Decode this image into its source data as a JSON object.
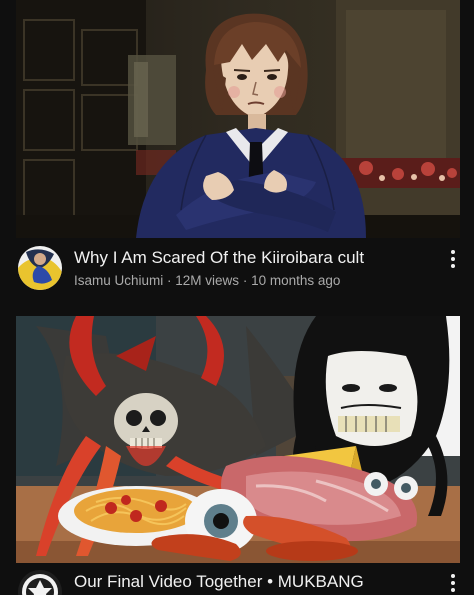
{
  "feed": {
    "videos": [
      {
        "title": "Why I Am Scared Of the Kiiroibara cult",
        "channel": "Isamu Uchiumi",
        "views": "12M views",
        "age": "10 months ago",
        "thumbnail_icon": "anime-character-thumbnail",
        "avatar_icon": "channel-avatar-blue-yellow"
      },
      {
        "title": "Our Final Video Together • MUKBANG",
        "thumbnail_icon": "mukbang-horror-thumbnail",
        "avatar_icon": "channel-avatar-crest"
      }
    ]
  },
  "colors": {
    "background": "#0f0f0f",
    "title_text": "#f1f1f1",
    "secondary_text": "#aaaaaa"
  }
}
